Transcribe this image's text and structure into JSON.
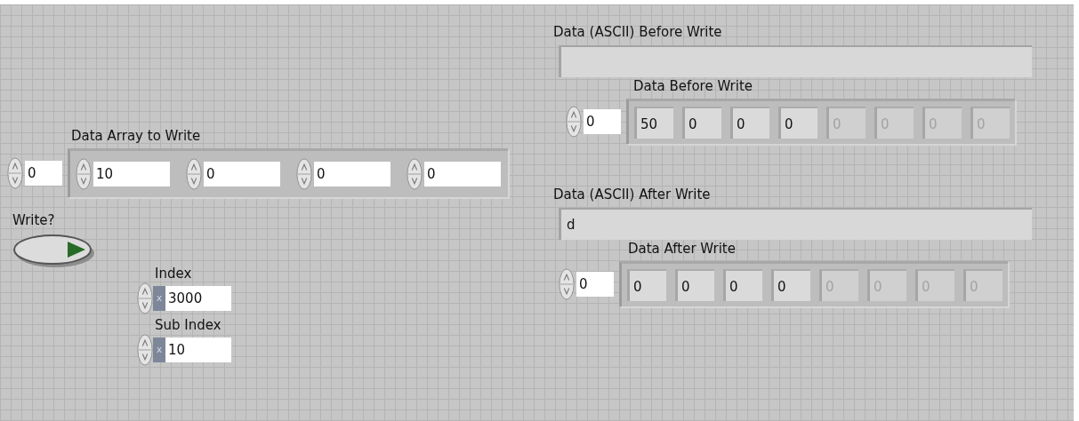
{
  "controls": {
    "array_label": "Data Array to Write",
    "array_index": "0",
    "array_values": [
      "10",
      "0",
      "0",
      "0"
    ],
    "write": {
      "label": "Write?",
      "on": false
    },
    "numerics": [
      {
        "label": "Index",
        "radix": "x",
        "value": "3000"
      },
      {
        "label": "Sub Index",
        "radix": "x",
        "value": "10"
      }
    ]
  },
  "indicators": [
    {
      "ascii_label": "Data (ASCII) Before Write",
      "array_label": "Data Before Write",
      "array_index": "0",
      "elements": [
        {
          "value": "50",
          "disabled": false
        },
        {
          "value": "0",
          "disabled": false
        },
        {
          "value": "0",
          "disabled": false
        },
        {
          "value": "0",
          "disabled": false
        },
        {
          "value": "0",
          "disabled": true
        },
        {
          "value": "0",
          "disabled": true
        },
        {
          "value": "0",
          "disabled": true
        },
        {
          "value": "0",
          "disabled": true
        }
      ]
    },
    {
      "ascii_label": "Data (ASCII) After Write",
      "ascii_value": "d",
      "array_label": "Data After Write",
      "array_index": "0",
      "elements": [
        {
          "value": "0",
          "disabled": false
        },
        {
          "value": "0",
          "disabled": false
        },
        {
          "value": "0",
          "disabled": false
        },
        {
          "value": "0",
          "disabled": false
        },
        {
          "value": "0",
          "disabled": true
        },
        {
          "value": "0",
          "disabled": true
        },
        {
          "value": "0",
          "disabled": true
        },
        {
          "value": "0",
          "disabled": true
        }
      ]
    }
  ]
}
